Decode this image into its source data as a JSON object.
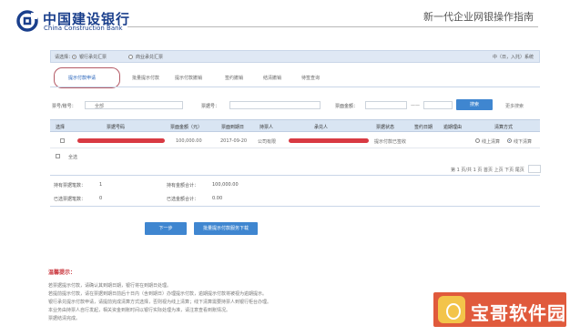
{
  "header": {
    "brand_cn": "中国建设银行",
    "brand_en": "China Construction Bank",
    "guide_title": "新一代企业网银操作指南",
    "brand_color": "#1a3f8c"
  },
  "query_bar": {
    "label": "请选择：",
    "option1": "银行承兑汇票",
    "option2": "商业承兑汇票",
    "selected": "银行承兑汇票",
    "right_text": "中（日，入托）系统"
  },
  "tabs": [
    {
      "label": "提示付款申请",
      "active": true
    },
    {
      "label": "批量提示付款",
      "active": false
    },
    {
      "label": "提示付款撤销",
      "active": false
    },
    {
      "label": "签约撤销",
      "active": false
    },
    {
      "label": "结清撤销",
      "active": false
    },
    {
      "label": "待签查询",
      "active": false
    }
  ],
  "filter": {
    "acct_label": "票号/账号：",
    "acct_value": "全部",
    "bill_no_label": "票据号：",
    "amount_label": "票面金额：",
    "dash": "——",
    "query_button": "搜索",
    "more_link": "更多搜索"
  },
  "table": {
    "columns": [
      "选择",
      "票据号码",
      "票面金额（元）",
      "票面到期日",
      "持票人",
      "承兑人",
      "票据状态",
      "签约日期",
      "逾期理由",
      "清算方式"
    ],
    "rows": [
      {
        "amount": "100,000.00",
        "due_date": "2017-09-20",
        "holder": "公司有限",
        "status": "提示付款已签收",
        "clearing_opt1": "线上清算",
        "clearing_opt2": "线下清算"
      }
    ],
    "select_all": "全选"
  },
  "pager": {
    "text": "第 1 页/共 1 页 首页 上页 下页 尾页"
  },
  "summary": {
    "total_count_label": "持有票据笔数：",
    "total_count": "1",
    "total_amount_label": "持有金额合计：",
    "total_amount": "100,000.00",
    "selected_count_label": "已选票据笔数：",
    "selected_count": "0",
    "selected_amount_label": "已选金额合计：",
    "selected_amount": "0.00"
  },
  "actions": {
    "next": "下一步",
    "batch": "批量提示付款服务下载"
  },
  "notes": {
    "title": "温馨提示：",
    "lines": [
      "若票据提示付款，请确认其到期日期，银行将在到期日处理。",
      "若提前提示付款，请在票据到期日前后十日内（含到期日）办理提示付款，逾期提示付款将被视为逾期提示。",
      "银行承兑提示付款申请，请提前完成清算方式选择，否则视为线上清算；线下清算需要持票人到银行柜台办理。",
      "本业务由持票人自行发起，相关资金到账时间以银行实际处理为准，请注意查看到账情况。",
      "票据结清完成。"
    ]
  },
  "watermark": {
    "text": "宝哥软件园"
  }
}
